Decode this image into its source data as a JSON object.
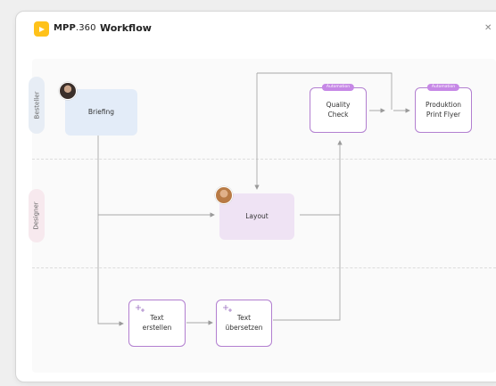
{
  "header": {
    "brand_bold": "MPP",
    "brand_light": ".360",
    "title": "Workflow",
    "close_icon": "close-icon"
  },
  "lanes": [
    {
      "label": "Besteller"
    },
    {
      "label": "Designer"
    }
  ],
  "nodes": {
    "briefing": {
      "label": "Briefing"
    },
    "layout": {
      "label": "Layout"
    },
    "quality": {
      "line1": "Quality",
      "line2": "Check",
      "badge": "Automation"
    },
    "produktion": {
      "line1": "Produktion",
      "line2": "Print Flyer",
      "badge": "Automation"
    },
    "text_erstellen": {
      "line1": "Text",
      "line2": "erstellen"
    },
    "text_uebersetzen": {
      "line1": "Text",
      "line2": "übersetzen"
    }
  },
  "colors": {
    "accent": "#b27fd0",
    "logo": "#ffc21a",
    "briefing": "#e3ecf8",
    "layout": "#efe3f4"
  }
}
